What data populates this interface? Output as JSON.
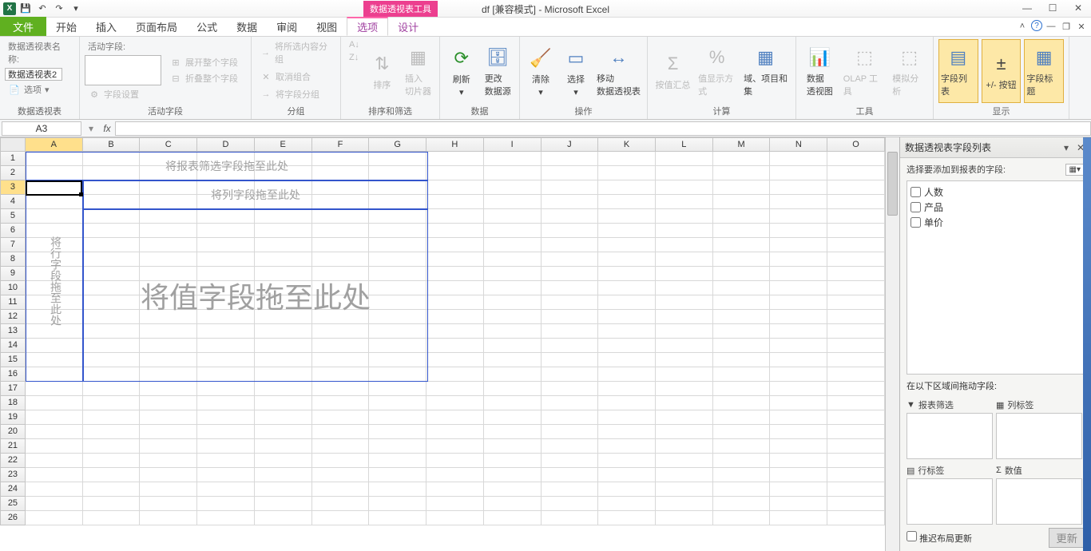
{
  "titlebar": {
    "context_tool": "数据透视表工具",
    "title": "df  [兼容模式] - Microsoft Excel"
  },
  "tabs": {
    "file": "文件",
    "home": "开始",
    "insert": "插入",
    "pagelayout": "页面布局",
    "formulas": "公式",
    "data": "数据",
    "review": "审阅",
    "view": "视图",
    "options": "选项",
    "design": "设计"
  },
  "ribbon": {
    "g1": {
      "name_label": "数据透视表名称:",
      "name_value": "数据透视表2",
      "options_btn": "选项",
      "group": "数据透视表"
    },
    "g2": {
      "active_label": "活动字段:",
      "expand": "展开整个字段",
      "collapse": "折叠整个字段",
      "settings": "字段设置",
      "group": "活动字段"
    },
    "g3": {
      "sel_group": "将所选内容分组",
      "ungroup": "取消组合",
      "field_group": "将字段分组",
      "group": "分组"
    },
    "g4": {
      "sort": "排序",
      "slicer": "插入\n切片器",
      "group": "排序和筛选"
    },
    "g5": {
      "refresh": "刷新",
      "change": "更改\n数据源",
      "group": "数据"
    },
    "g6": {
      "clear": "清除",
      "select": "选择",
      "move": "移动\n数据透视表",
      "group": "操作"
    },
    "g7": {
      "byvalue": "按值汇总",
      "display": "值显示方式",
      "fields": "域、项目和\n集",
      "group": "计算"
    },
    "g8": {
      "pivotchart": "数据\n透视图",
      "olap": "OLAP 工具",
      "whatif": "模拟分析",
      "group": "工具"
    },
    "g9": {
      "fieldlist": "字段列表",
      "plusminus": "+/- 按钮",
      "headers": "字段标题",
      "group": "显示"
    }
  },
  "namebox": "A3",
  "columns": [
    "A",
    "B",
    "C",
    "D",
    "E",
    "F",
    "G",
    "H",
    "I",
    "J",
    "K",
    "L",
    "M",
    "N",
    "O"
  ],
  "rows": [
    "1",
    "2",
    "3",
    "4",
    "5",
    "6",
    "7",
    "8",
    "9",
    "10",
    "11",
    "12",
    "13",
    "14",
    "15",
    "16",
    "17",
    "18",
    "19",
    "20",
    "21",
    "22",
    "23",
    "24",
    "25",
    "26"
  ],
  "pivot": {
    "filter": "将报表筛选字段拖至此处",
    "cols": "将列字段拖至此处",
    "rows_txt": "将行字段拖至此处",
    "values": "将值字段拖至此处"
  },
  "fieldpane": {
    "title": "数据透视表字段列表",
    "subtitle": "选择要添加到报表的字段:",
    "fields": {
      "f1": "人数",
      "f2": "产品",
      "f3": "单价"
    },
    "dragtitle": "在以下区域间拖动字段:",
    "zone_filter": "报表筛选",
    "zone_cols": "列标签",
    "zone_rows": "行标签",
    "zone_vals": "数值",
    "defer": "推迟布局更新",
    "update": "更新"
  },
  "chart_data": null
}
